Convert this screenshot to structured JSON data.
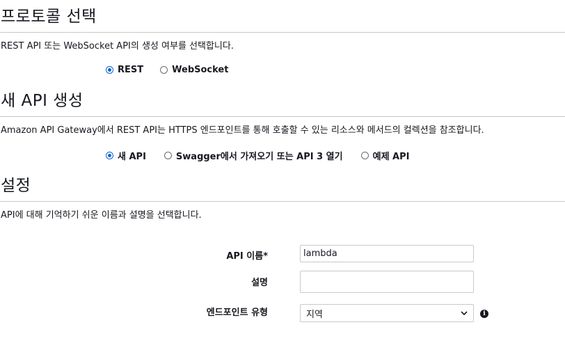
{
  "protocol": {
    "title": "프로토콜 선택",
    "description": "REST API 또는 WebSocket API의 생성 여부를 선택합니다.",
    "options": [
      {
        "label": "REST",
        "checked": true
      },
      {
        "label": "WebSocket",
        "checked": false
      }
    ]
  },
  "new_api": {
    "title": "새 API 생성",
    "description": "Amazon API Gateway에서 REST API는 HTTPS 엔드포인트를 통해 호출할 수 있는 리소스와 메서드의 컬렉션을 참조합니다.",
    "options": [
      {
        "label": "새 API",
        "checked": true
      },
      {
        "label": "Swagger에서 가져오기 또는 API 3 열기",
        "checked": false
      },
      {
        "label": "예제 API",
        "checked": false
      }
    ]
  },
  "settings": {
    "title": "설정",
    "description": "API에 대해 기억하기 쉬운 이름과 설명을 선택합니다.",
    "api_name_label": "API 이름*",
    "api_name_value": "lambda",
    "description_label": "설명",
    "description_value": "",
    "endpoint_type_label": "엔드포인트 유형",
    "endpoint_type_value": "지역"
  }
}
